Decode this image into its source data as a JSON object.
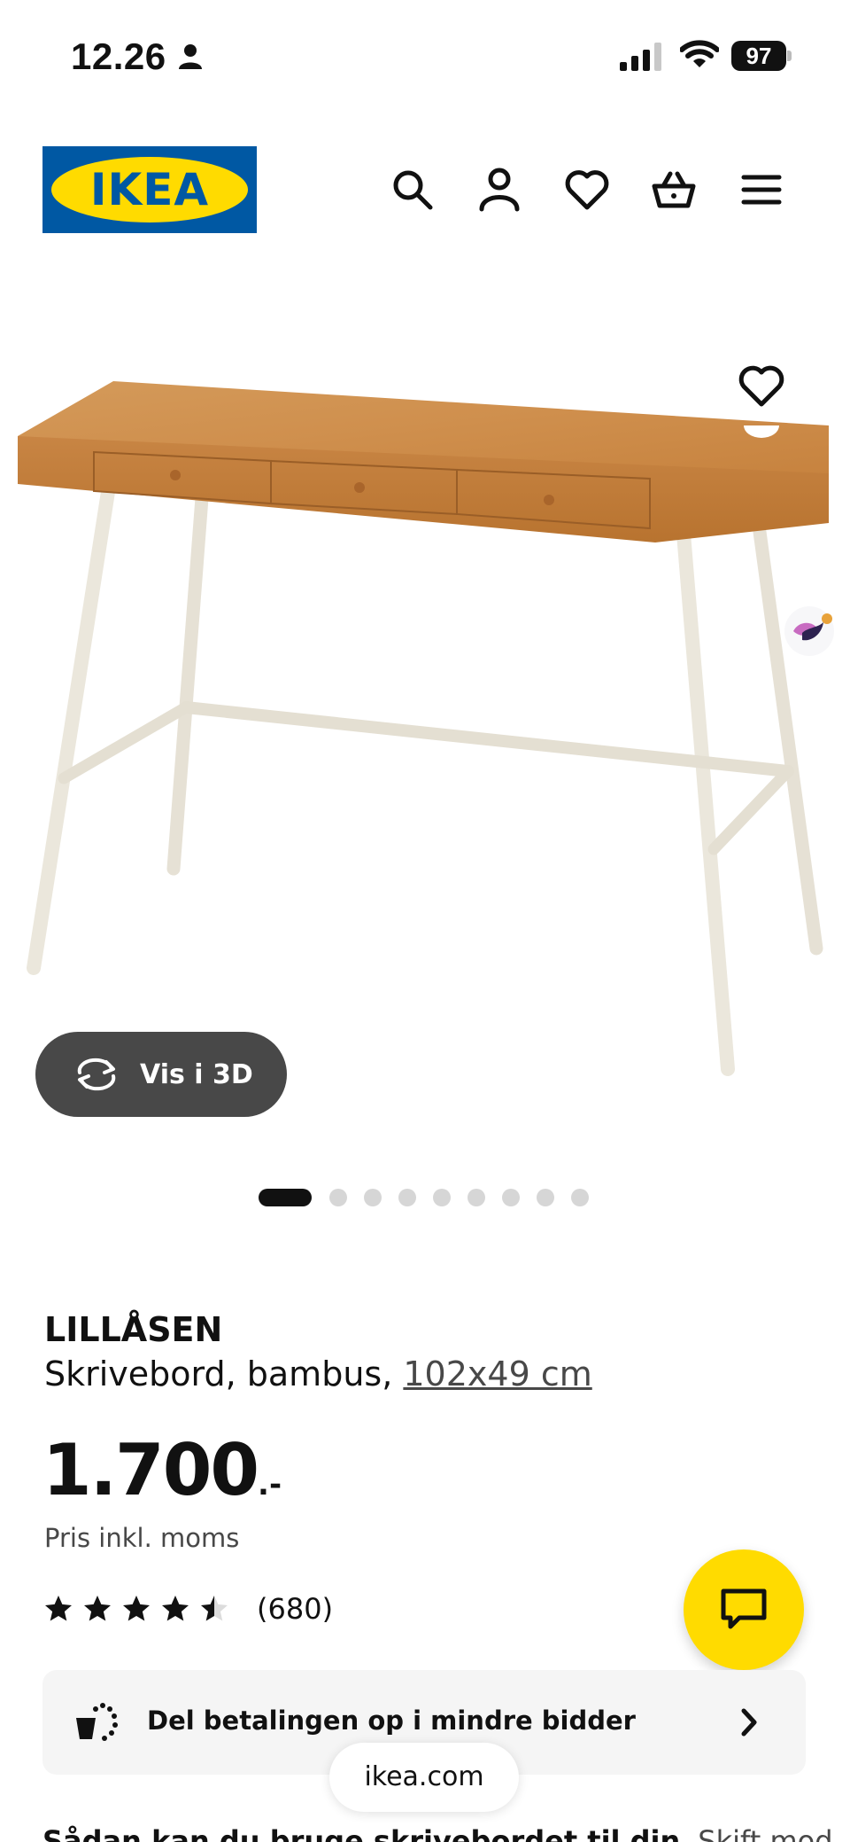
{
  "status_bar": {
    "time": "12.26",
    "battery": "97"
  },
  "header": {
    "logo_text": "IKEA",
    "brand_colors": {
      "blue": "#0058a3",
      "yellow": "#ffdb00"
    },
    "icons": [
      "search-icon",
      "user-icon",
      "heart-icon",
      "basket-icon",
      "menu-icon"
    ]
  },
  "gallery": {
    "view_3d_label": "Vis i 3D",
    "image_count": 9,
    "active_index": 0
  },
  "product": {
    "name": "LILLÅSEN",
    "desc_prefix": "Skrivebord, bambus, ",
    "dimensions": "102x49 cm",
    "price": "1.700",
    "price_suffix": ".-",
    "price_note": "Pris inkl. moms",
    "rating_value": 4.5,
    "rating_count": "(680)"
  },
  "payment": {
    "label": "Del betalingen op i mindre bidder"
  },
  "browser": {
    "url": "ikea.com"
  },
  "next_section": {
    "bold_text": "Sådan kan du bruge skrivebordet til din",
    "light_text": "Skift mod"
  }
}
